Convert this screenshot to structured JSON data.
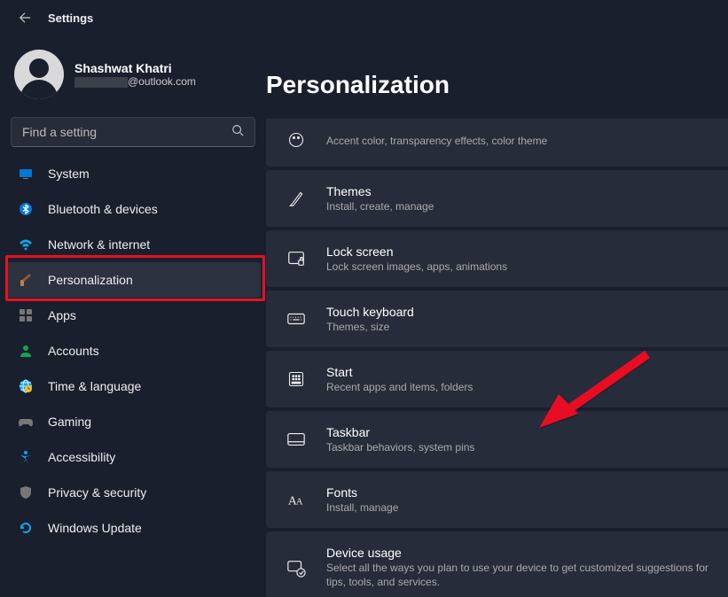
{
  "header": {
    "title": "Settings"
  },
  "user": {
    "name": "Shashwat Khatri",
    "email_suffix": "@outlook.com"
  },
  "search": {
    "placeholder": "Find a setting"
  },
  "sidebar": {
    "items": [
      {
        "label": "System"
      },
      {
        "label": "Bluetooth & devices"
      },
      {
        "label": "Network & internet"
      },
      {
        "label": "Personalization"
      },
      {
        "label": "Apps"
      },
      {
        "label": "Accounts"
      },
      {
        "label": "Time & language"
      },
      {
        "label": "Gaming"
      },
      {
        "label": "Accessibility"
      },
      {
        "label": "Privacy & security"
      },
      {
        "label": "Windows Update"
      }
    ]
  },
  "page": {
    "title": "Personalization",
    "items": [
      {
        "title": "",
        "sub": "Accent color, transparency effects, color theme"
      },
      {
        "title": "Themes",
        "sub": "Install, create, manage"
      },
      {
        "title": "Lock screen",
        "sub": "Lock screen images, apps, animations"
      },
      {
        "title": "Touch keyboard",
        "sub": "Themes, size"
      },
      {
        "title": "Start",
        "sub": "Recent apps and items, folders"
      },
      {
        "title": "Taskbar",
        "sub": "Taskbar behaviors, system pins"
      },
      {
        "title": "Fonts",
        "sub": "Install, manage"
      },
      {
        "title": "Device usage",
        "sub": "Select all the ways you plan to use your device to get customized suggestions for tips, tools, and services."
      }
    ]
  }
}
